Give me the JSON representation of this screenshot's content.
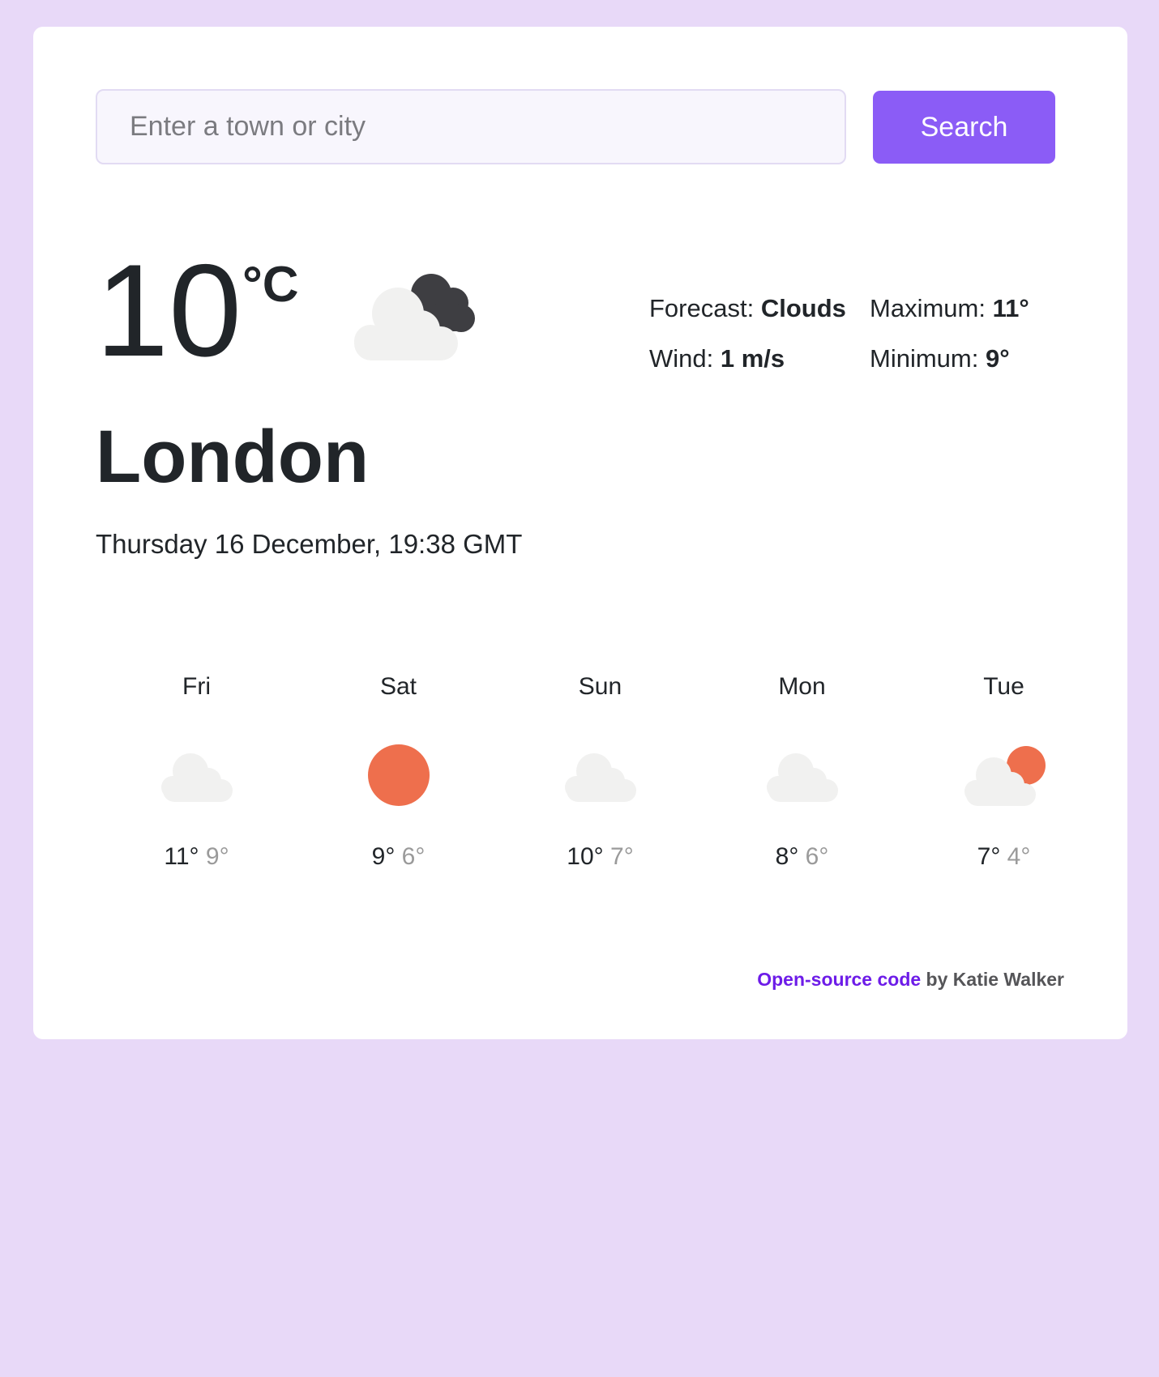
{
  "search": {
    "placeholder": "Enter a town or city",
    "value": "",
    "button_label": "Search"
  },
  "current": {
    "temperature": "10",
    "unit": "°C",
    "icon": "cloud-with-dark-cloud-icon",
    "city": "London",
    "datetime": "Thursday 16 December, 19:38 GMT",
    "forecast_label": "Forecast: ",
    "forecast_value": "Clouds",
    "wind_label": "Wind: ",
    "wind_value": "1 m/s",
    "maximum_label": "Maximum: ",
    "maximum_value": "11°",
    "minimum_label": "Minimum: ",
    "minimum_value": "9°"
  },
  "forecast": [
    {
      "day": "Fri",
      "icon": "cloud-icon",
      "max": "11°",
      "min": "9°"
    },
    {
      "day": "Sat",
      "icon": "sun-icon",
      "max": "9°",
      "min": "6°"
    },
    {
      "day": "Sun",
      "icon": "cloud-icon",
      "max": "10°",
      "min": "7°"
    },
    {
      "day": "Mon",
      "icon": "cloud-icon",
      "max": "8°",
      "min": "6°"
    },
    {
      "day": "Tue",
      "icon": "sun-behind-cloud-icon",
      "max": "7°",
      "min": "4°"
    }
  ],
  "footer": {
    "link_label": "Open-source code",
    "by_text": " by Katie Walker"
  },
  "colors": {
    "background": "#e8d9f8",
    "accent": "#8b5cf6",
    "link": "#6d1ce8",
    "sun": "#ee6f4d",
    "cloud": "#f1f1f0",
    "dark_cloud": "#3e3e42"
  }
}
